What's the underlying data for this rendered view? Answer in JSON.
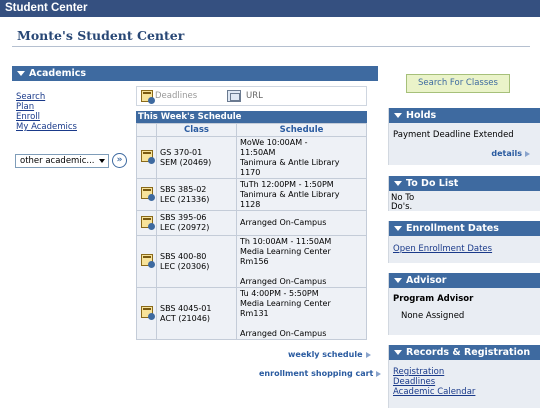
{
  "window": {
    "title": "Student Center"
  },
  "page": {
    "heading": "Monte's Student Center"
  },
  "academics": {
    "header": "Academics",
    "links": [
      "Search",
      "Plan",
      "Enroll",
      "My Academics"
    ],
    "other_select": "other academic...",
    "go_symbol": "»",
    "deadlines_label": "Deadlines",
    "url_label": "URL"
  },
  "schedule": {
    "header": "This Week's Schedule",
    "columns": [
      "Class",
      "Schedule"
    ],
    "rows": [
      {
        "cls": [
          "GS 370-01",
          "SEM (20469)"
        ],
        "sched": [
          "MoWe 10:00AM -",
          "11:50AM",
          "Tanimura & Antle Library",
          "1170"
        ]
      },
      {
        "cls": [
          "SBS 385-02",
          "LEC (21336)"
        ],
        "sched": [
          "TuTh 12:00PM - 1:50PM",
          "Tanimura & Antle Library",
          "1128"
        ]
      },
      {
        "cls": [
          "SBS 395-06",
          "LEC (20972)"
        ],
        "sched": [
          "Arranged On-Campus"
        ]
      },
      {
        "cls": [
          "SBS 400-80",
          "LEC (20306)"
        ],
        "sched": [
          "Th 10:00AM - 11:50AM",
          "Media Learning Center",
          "Rm156",
          "",
          "Arranged On-Campus"
        ]
      },
      {
        "cls": [
          "SBS 4045-01",
          "ACT (21046)"
        ],
        "sched": [
          "Tu 4:00PM - 5:50PM",
          "Media Learning Center",
          "Rm131",
          "",
          "Arranged On-Campus"
        ]
      }
    ],
    "weekly_link": "weekly schedule",
    "cart_link": "enrollment shopping cart"
  },
  "search_classes_button": "Search For Classes",
  "holds": {
    "header": "Holds",
    "text": "Payment Deadline Extended",
    "details": "details"
  },
  "todo": {
    "header": "To Do List",
    "text_line1": "No To",
    "text_line2": "Do's."
  },
  "enrollment_dates": {
    "header": "Enrollment Dates",
    "link": "Open Enrollment Dates"
  },
  "advisor": {
    "header": "Advisor",
    "label": "Program Advisor",
    "value": "None Assigned"
  },
  "records": {
    "header": "Records & Registration",
    "links": [
      "Registration",
      "Deadlines",
      "Academic Calendar"
    ]
  },
  "colors": {
    "titlebar": "#355080",
    "section_header": "#3e6aa0",
    "panel_bg": "#e9edf3",
    "link": "#1a3a8a",
    "search_button_bg": "#eaf3c9"
  }
}
